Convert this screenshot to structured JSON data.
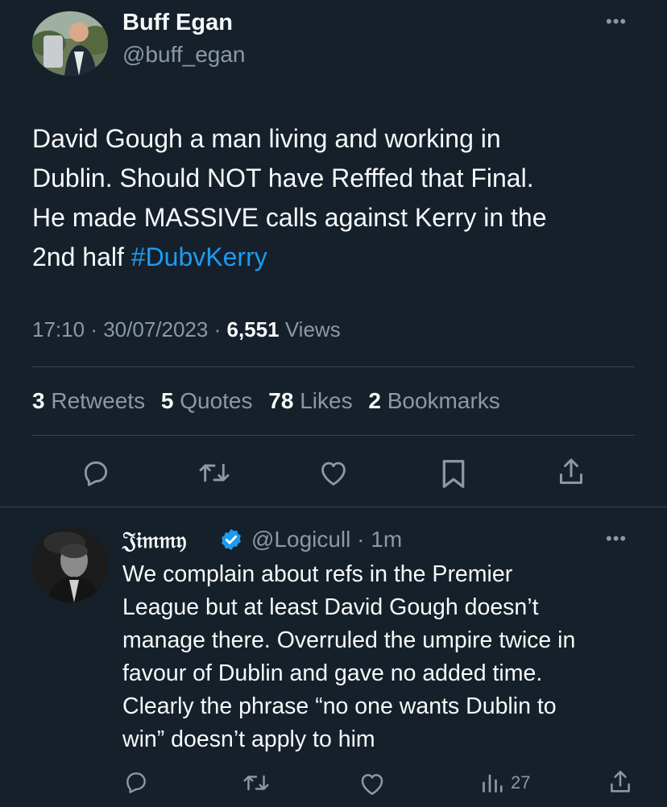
{
  "main_tweet": {
    "author_name": "Buff Egan",
    "author_handle": "@buff_egan",
    "text_lines": [
      "David Gough a man living and working in",
      "Dublin. Should NOT have Refffed that Final.",
      "He made MASSIVE calls against Kerry in the"
    ],
    "text_last_prefix": "2nd half ",
    "hashtag": "#DubvKerry",
    "time": "17:10",
    "date": "30/07/2023",
    "views_count": "6,551",
    "views_label": "Views",
    "stats": {
      "retweets_count": "3",
      "retweets_label": "Retweets",
      "quotes_count": "5",
      "quotes_label": "Quotes",
      "likes_count": "78",
      "likes_label": "Likes",
      "bookmarks_count": "2",
      "bookmarks_label": "Bookmarks"
    },
    "actions": [
      "reply-icon",
      "retweet-icon",
      "like-icon",
      "bookmark-icon",
      "share-icon"
    ]
  },
  "reply": {
    "author_name": "𝔍𝔦𝔪𝔪𝔶",
    "verified": true,
    "author_handle": "@Logicull",
    "time_ago": "1m",
    "text_lines": [
      "We complain about refs in the Premier",
      "League but at least David Gough doesn’t",
      "manage there. Overruled the umpire twice in",
      "favour of Dublin and gave no added time.",
      "Clearly the phrase “no one wants Dublin to",
      "win” doesn’t apply to him"
    ],
    "views": "27",
    "actions": [
      "reply-icon",
      "retweet-icon",
      "like-icon",
      "views-icon",
      "share-icon"
    ]
  },
  "colors": {
    "background": "#15202b",
    "text": "#f7f9f9",
    "secondary": "#8b98a5",
    "accent": "#1d9bf0",
    "divider": "#38444d"
  }
}
